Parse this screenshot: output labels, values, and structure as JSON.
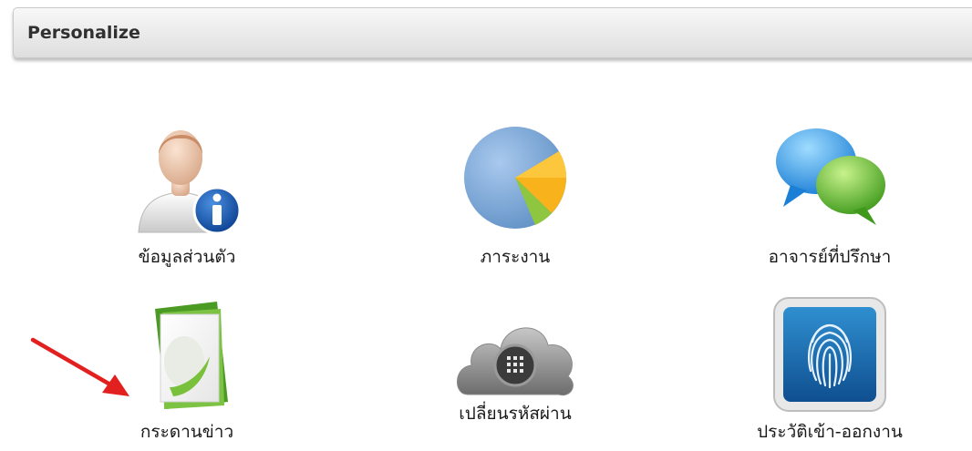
{
  "panel": {
    "title": "Personalize"
  },
  "menu": [
    {
      "label": "ข้อมูลส่วนตัว",
      "icon": "user-info-icon"
    },
    {
      "label": "ภาระงาน",
      "icon": "pie-chart-icon"
    },
    {
      "label": "อาจารย์ที่ปรึกษา",
      "icon": "chat-bubbles-icon"
    },
    {
      "label": "กระดานข่าว",
      "icon": "news-board-icon"
    },
    {
      "label": "เปลี่ยนรหัสผ่าน",
      "icon": "cloud-lock-icon"
    },
    {
      "label": "ประวัติเข้า-ออกงาน",
      "icon": "fingerprint-icon"
    }
  ],
  "colors": {
    "arrow": "#e32020",
    "header_text": "#303030"
  }
}
